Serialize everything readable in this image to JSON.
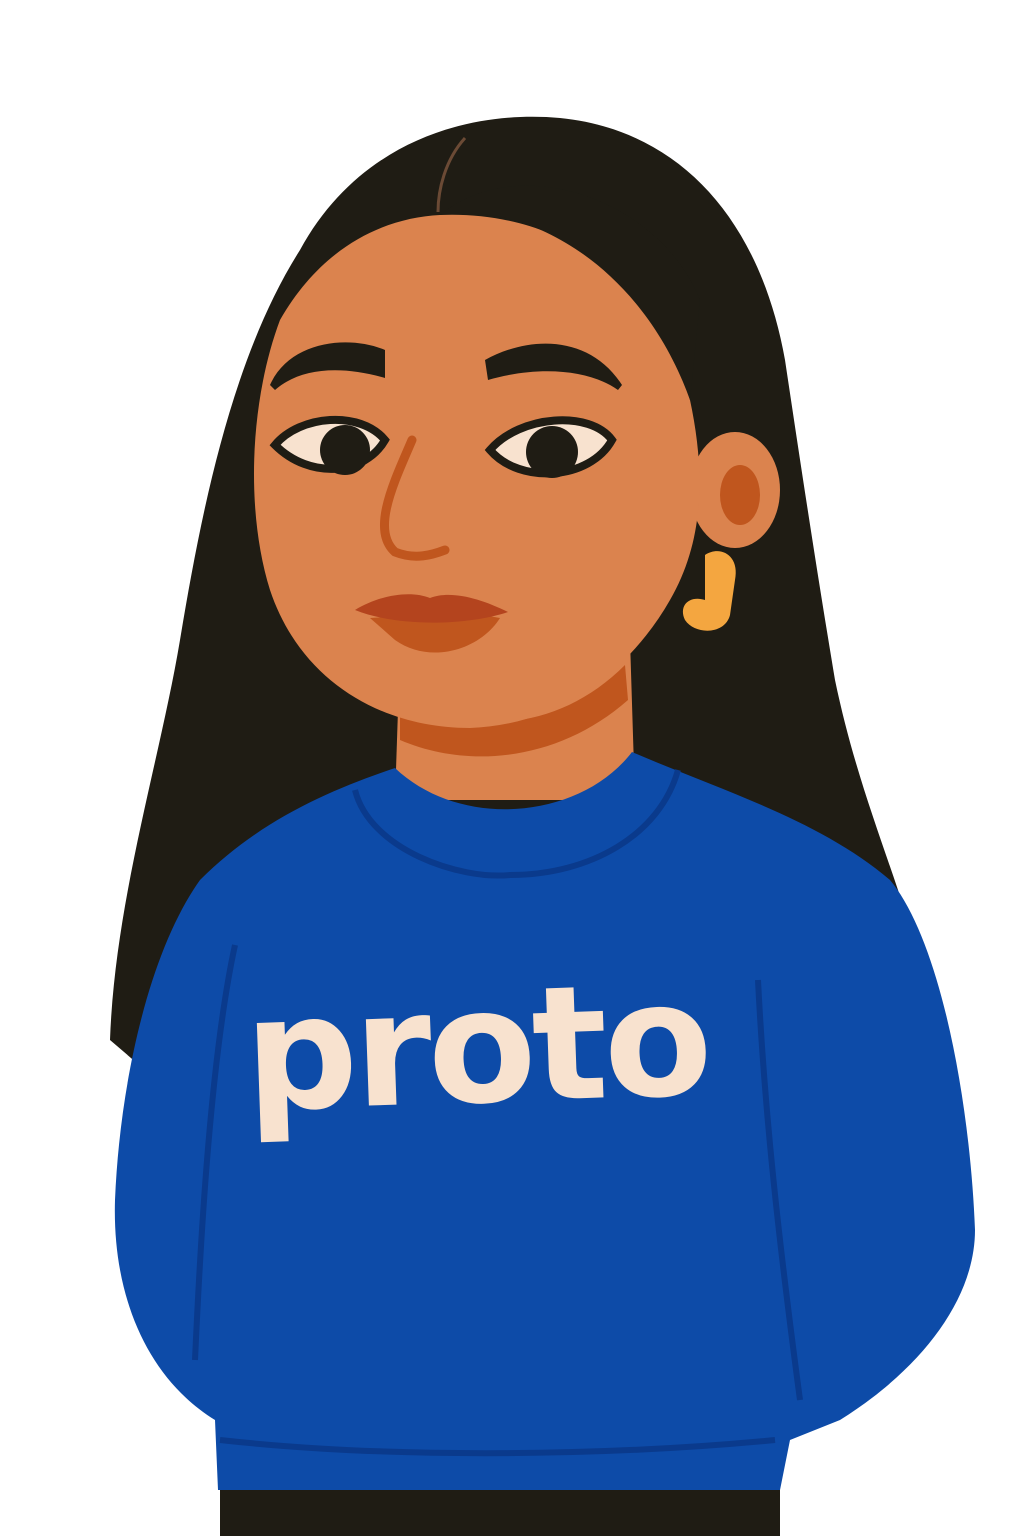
{
  "illustration": {
    "subject": "avatar",
    "shirt_text": "proto",
    "colors": {
      "hair": "#1f1c14",
      "skin": "#db834e",
      "skin_shadow": "#c0561e",
      "sweater": "#0d4ba8",
      "sweater_line": "#0a3a8c",
      "shirt_text": "#f8e2cf",
      "earring": "#f4a640",
      "lips": "#b4441e"
    }
  }
}
